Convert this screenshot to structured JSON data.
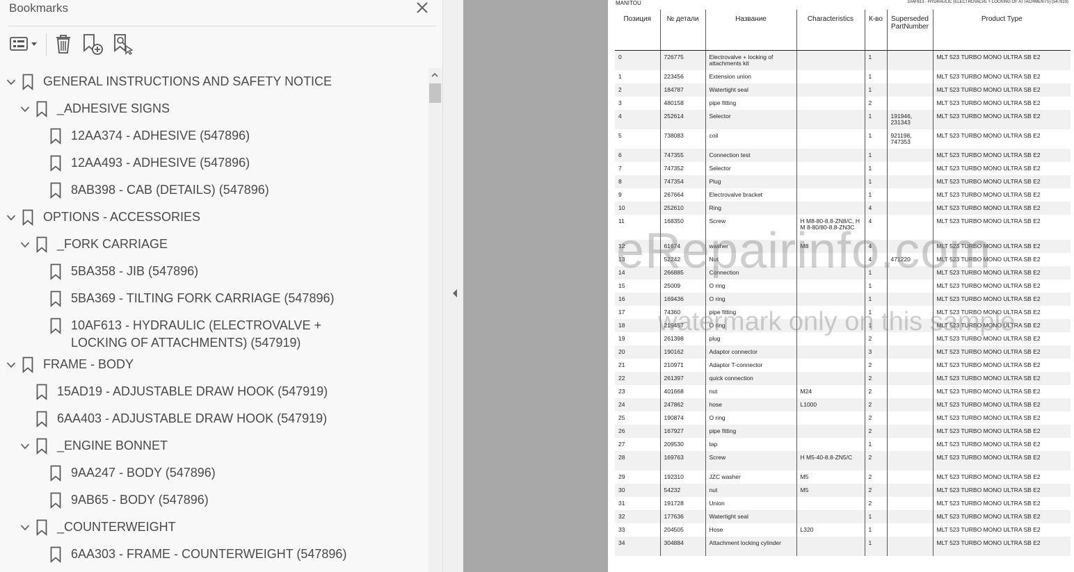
{
  "panel": {
    "title": "Bookmarks",
    "toolbar": {
      "options": "options-menu-icon",
      "delete": "trash-icon",
      "new": "new-bookmark-icon",
      "find": "find-bookmark-icon"
    }
  },
  "bookmarks": [
    {
      "label": "GENERAL INSTRUCTIONS AND SAFETY NOTICE",
      "level": 0,
      "expandable": true
    },
    {
      "label": "_ADHESIVE SIGNS",
      "level": 1,
      "expandable": true
    },
    {
      "label": "12AA374 - ADHESIVE (547896)",
      "level": 2,
      "expandable": false
    },
    {
      "label": "12AA493 - ADHESIVE (547896)",
      "level": 2,
      "expandable": false
    },
    {
      "label": "8AB398 - CAB (DETAILS) (547896)",
      "level": 2,
      "expandable": false
    },
    {
      "label": "OPTIONS - ACCESSORIES",
      "level": 0,
      "expandable": true
    },
    {
      "label": "_FORK CARRIAGE",
      "level": 1,
      "expandable": true
    },
    {
      "label": "5BA358 - JIB (547896)",
      "level": 2,
      "expandable": false
    },
    {
      "label": "5BA369 - TILTING FORK CARRIAGE (547896)",
      "level": 2,
      "expandable": false
    },
    {
      "label": "10AF613 - HYDRAULIC (ELECTROVALVE + LOCKING OF ATTACHMENTS) (547919)",
      "level": 2,
      "expandable": false
    },
    {
      "label": "FRAME - BODY",
      "level": 0,
      "expandable": true
    },
    {
      "label": "15AD19 - ADJUSTABLE DRAW HOOK (547919)",
      "level": 1,
      "expandable": false
    },
    {
      "label": "6AA403 - ADJUSTABLE DRAW HOOK (547919)",
      "level": 1,
      "expandable": false
    },
    {
      "label": "_ENGINE BONNET",
      "level": 1,
      "expandable": true
    },
    {
      "label": "9AA247 - BODY (547896)",
      "level": 2,
      "expandable": false
    },
    {
      "label": "9AB65 - BODY (547896)",
      "level": 2,
      "expandable": false
    },
    {
      "label": "_COUNTERWEIGHT",
      "level": 1,
      "expandable": true
    },
    {
      "label": "6AA303 - FRAME - COUNTERWEIGHT (547896)",
      "level": 2,
      "expandable": false
    }
  ],
  "document": {
    "brand": "MANITOU",
    "title": "10AF613 - HYDRAULIC (ELECTROVALVE + LOCKING OF ATTACHMENTS) (547919)",
    "watermark_main": "eRepairinfo.com",
    "watermark_sub": "watermark only on this sample",
    "columns": [
      "Позиция",
      "№ детали",
      "Название",
      "Characteristics",
      "К-во",
      "Superseded PartNumber",
      "Product Type"
    ],
    "rows": [
      [
        "0",
        "726775",
        "Electrovalve + locking of attachments kit",
        "",
        "1",
        "",
        "MLT 523 TURBO MONO ULTRA SB E2"
      ],
      [
        "1",
        "223456",
        "Extension union",
        "",
        "1",
        "",
        "MLT 523 TURBO MONO ULTRA SB E2"
      ],
      [
        "2",
        "184787",
        "Watertight seal",
        "",
        "1",
        "",
        "MLT 523 TURBO MONO ULTRA SB E2"
      ],
      [
        "3",
        "480158",
        "pipe fitting",
        "",
        "2",
        "",
        "MLT 523 TURBO MONO ULTRA SB E2"
      ],
      [
        "4",
        "252614",
        "Selector",
        "",
        "1",
        "191946, 231343",
        "MLT 523 TURBO MONO ULTRA SB E2"
      ],
      [
        "5",
        "738083",
        "coil",
        "",
        "1",
        "921198, 747353",
        "MLT 523 TURBO MONO ULTRA SB E2"
      ],
      [
        "6",
        "747355",
        "Connection test",
        "",
        "1",
        "",
        "MLT 523 TURBO MONO ULTRA SB E2"
      ],
      [
        "7",
        "747352",
        "Selector",
        "",
        "1",
        "",
        "MLT 523 TURBO MONO ULTRA SB E2"
      ],
      [
        "8",
        "747354",
        "Plug",
        "",
        "1",
        "",
        "MLT 523 TURBO MONO ULTRA SB E2"
      ],
      [
        "9",
        "267664",
        "Electrovalve bracket",
        "",
        "1",
        "",
        "MLT 523 TURBO MONO ULTRA SB E2"
      ],
      [
        "10",
        "252610",
        "Ring",
        "",
        "4",
        "",
        "MLT 523 TURBO MONO ULTRA SB E2"
      ],
      [
        "11",
        "168350",
        "Screw",
        "H M8-80-8.8-ZN8/C, H M 8-80/80-8.8-ZN3C",
        "4",
        "",
        "MLT 523 TURBO MONO ULTRA SB E2"
      ],
      [
        "12",
        "61674",
        "washer",
        "M8",
        "4",
        "",
        "MLT 523 TURBO MONO ULTRA SB E2"
      ],
      [
        "13",
        "52242",
        "Nut",
        "",
        "4",
        "471220",
        "MLT 523 TURBO MONO ULTRA SB E2"
      ],
      [
        "14",
        "266885",
        "Connection",
        "",
        "1",
        "",
        "MLT 523 TURBO MONO ULTRA SB E2"
      ],
      [
        "15",
        "25009",
        "O ring",
        "",
        "1",
        "",
        "MLT 523 TURBO MONO ULTRA SB E2"
      ],
      [
        "16",
        "169436",
        "O ring",
        "",
        "1",
        "",
        "MLT 523 TURBO MONO ULTRA SB E2"
      ],
      [
        "17",
        "74360",
        "pipe fitting",
        "",
        "1",
        "",
        "MLT 523 TURBO MONO ULTRA SB E2"
      ],
      [
        "18",
        "219457",
        "O ring",
        "",
        "1",
        "",
        "MLT 523 TURBO MONO ULTRA SB E2"
      ],
      [
        "19",
        "261398",
        "plug",
        "",
        "2",
        "",
        "MLT 523 TURBO MONO ULTRA SB E2"
      ],
      [
        "20",
        "190162",
        "Adaptor connector",
        "",
        "3",
        "",
        "MLT 523 TURBO MONO ULTRA SB E2"
      ],
      [
        "21",
        "210971",
        "Adaptor T-connector",
        "",
        "2",
        "",
        "MLT 523 TURBO MONO ULTRA SB E2"
      ],
      [
        "22",
        "261397",
        "quick connection",
        "",
        "2",
        "",
        "MLT 523 TURBO MONO ULTRA SB E2"
      ],
      [
        "23",
        "401668",
        "nut",
        "M24",
        "2",
        "",
        "MLT 523 TURBO MONO ULTRA SB E2"
      ],
      [
        "24",
        "247862",
        "hose",
        "L1000",
        "2",
        "",
        "MLT 523 TURBO MONO ULTRA SB E2"
      ],
      [
        "25",
        "190874",
        "O ring",
        "",
        "2",
        "",
        "MLT 523 TURBO MONO ULTRA SB E2"
      ],
      [
        "26",
        "167927",
        "pipe fitting",
        "",
        "2",
        "",
        "MLT 523 TURBO MONO ULTRA SB E2"
      ],
      [
        "27",
        "209530",
        "tap",
        "",
        "1",
        "",
        "MLT 523 TURBO MONO ULTRA SB E2"
      ],
      [
        "28",
        "169763",
        "Screw",
        "H M5-40-8.8-ZN5/C",
        "2",
        "",
        "MLT 523 TURBO MONO ULTRA SB E2"
      ],
      [
        "29",
        "192310",
        "JZC washer",
        "M5",
        "2",
        "",
        "MLT 523 TURBO MONO ULTRA SB E2"
      ],
      [
        "30",
        "54232",
        "nut",
        "M5",
        "2",
        "",
        "MLT 523 TURBO MONO ULTRA SB E2"
      ],
      [
        "31",
        "191728",
        "Union",
        "",
        "2",
        "",
        "MLT 523 TURBO MONO ULTRA SB E2"
      ],
      [
        "32",
        "177636",
        "Watertight seal",
        "",
        "1",
        "",
        "MLT 523 TURBO MONO ULTRA SB E2"
      ],
      [
        "33",
        "204505",
        "Hose",
        "L320",
        "1",
        "",
        "MLT 523 TURBO MONO ULTRA SB E2"
      ],
      [
        "34",
        "304884",
        "Attachment locking cylinder",
        "",
        "1",
        "",
        "MLT 523 TURBO MONO ULTRA SB E2"
      ]
    ]
  }
}
